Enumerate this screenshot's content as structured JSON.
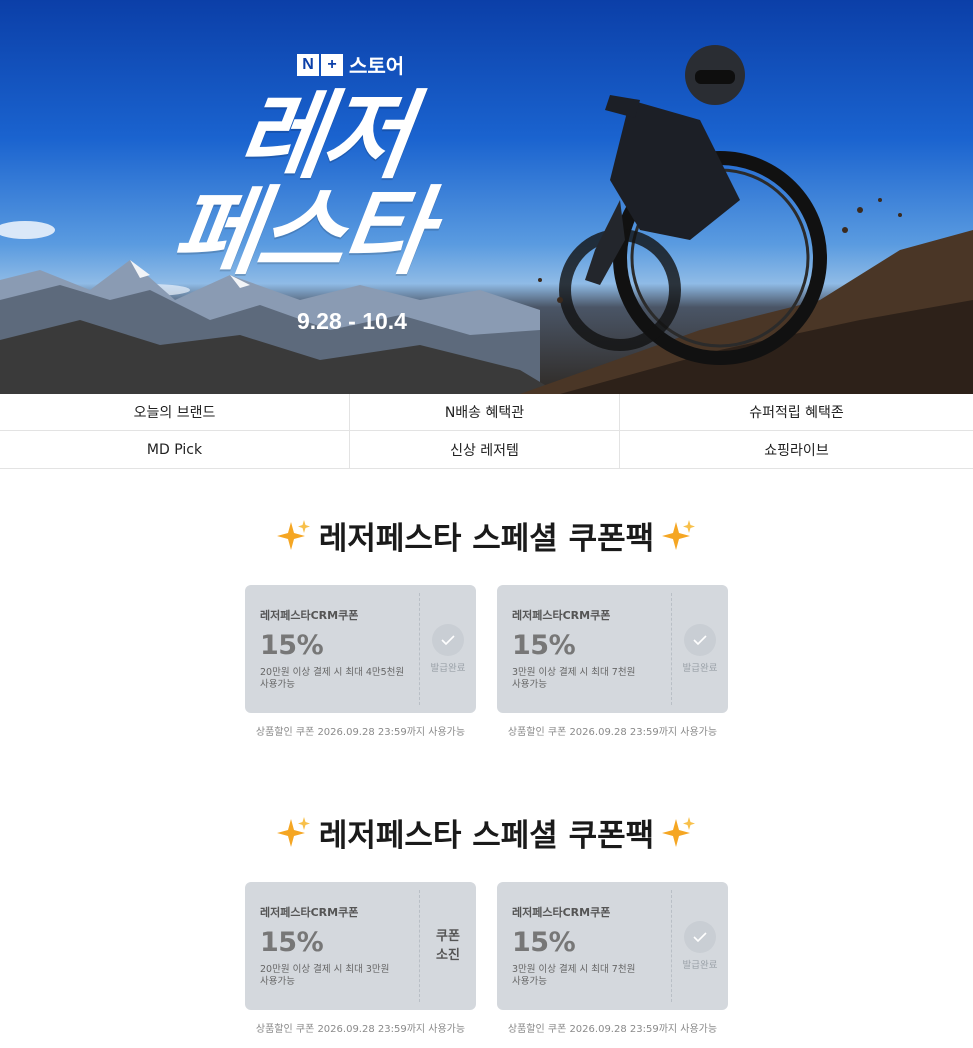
{
  "hero": {
    "brand_mark": "N+",
    "brand_name": "스토어",
    "title_line1": "레저",
    "title_line2": "페스타",
    "date": "9.28 - 10.4"
  },
  "nav": [
    {
      "label": "오늘의 브랜드"
    },
    {
      "label": "N배송 혜택관"
    },
    {
      "label": "슈퍼적립 혜택존"
    },
    {
      "label": "MD Pick"
    },
    {
      "label": "신상 레저템"
    },
    {
      "label": "쇼핑라이브"
    }
  ],
  "sections": [
    {
      "title": "레저페스타 스페셜 쿠폰팩",
      "coupons": [
        {
          "name": "레저페스타CRM쿠폰",
          "percent": "15%",
          "cond1": "20만원 이상 결제 시 최대 4만5천원",
          "cond2": "사용가능",
          "status": "발급완료",
          "note": "상품할인 쿠폰 2026.09.28 23:59까지 사용가능"
        },
        {
          "name": "레저페스타CRM쿠폰",
          "percent": "15%",
          "cond1": "3만원 이상 결제 시 최대 7천원",
          "cond2": "사용가능",
          "status": "발급완료",
          "note": "상품할인 쿠폰 2026.09.28 23:59까지 사용가능"
        }
      ]
    },
    {
      "title": "레저페스타 스페셜 쿠폰팩",
      "coupons": [
        {
          "name": "레저페스타CRM쿠폰",
          "percent": "15%",
          "cond1": "20만원 이상 결제 시 최대 3만원",
          "cond2": "사용가능",
          "status_line1": "쿠폰",
          "status_line2": "소진",
          "note": "상품할인 쿠폰 2026.09.28 23:59까지 사용가능"
        },
        {
          "name": "레저페스타CRM쿠폰",
          "percent": "15%",
          "cond1": "3만원 이상 결제 시 최대 7천원",
          "cond2": "사용가능",
          "status": "발급완료",
          "note": "상품할인 쿠폰 2026.09.28 23:59까지 사용가능"
        }
      ]
    }
  ],
  "colors": {
    "accent": "#0b3fa8",
    "coupon_bg": "#d4d8dd",
    "sparkle": "#f5a623"
  }
}
